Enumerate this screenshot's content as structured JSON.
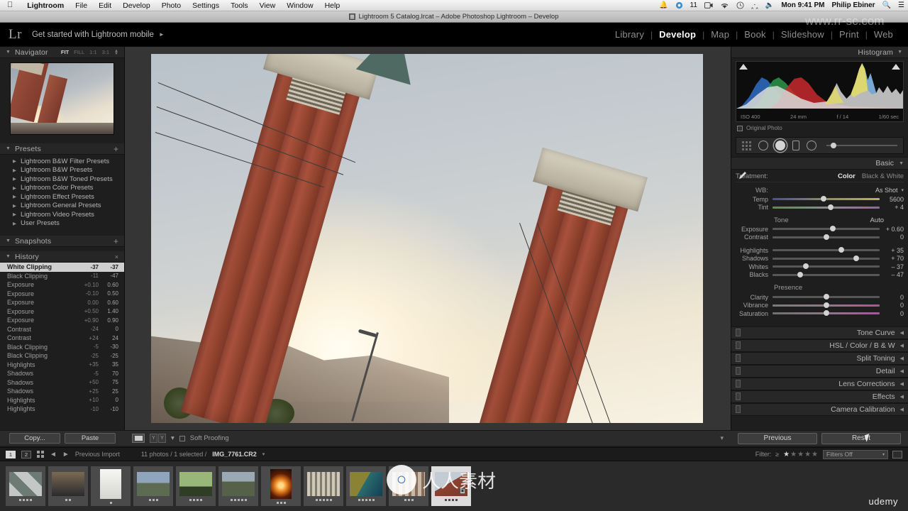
{
  "menubar": {
    "apple_icon": "apple-icon",
    "items": [
      "Lightroom",
      "File",
      "Edit",
      "Develop",
      "Photo",
      "Settings",
      "Tools",
      "View",
      "Window",
      "Help"
    ],
    "status": {
      "bell_icon": "bell-icon",
      "dropbox_icon": "dropbox-icon",
      "dropbox_count": "11",
      "screen_icon": "screen-record-icon",
      "wifi_icon": "wifi-icon",
      "clock_icon": "clock-icon",
      "bluetooth_icon": "bluetooth-icon",
      "volume_icon": "volume-icon",
      "time": "Mon 9:41 PM",
      "user": "Philip Ebiner",
      "search_icon": "search-icon",
      "notification_icon": "notification-center-icon"
    }
  },
  "titlebar": {
    "doc_icon": "catalog-file-icon",
    "title": "Lightroom 5 Catalog.lrcat – Adobe Photoshop Lightroom – Develop"
  },
  "identity": {
    "logo": "Lr",
    "tagline": "Get started with Lightroom mobile",
    "tagline_arrow": "►",
    "modules": [
      {
        "label": "Library",
        "active": false
      },
      {
        "label": "Develop",
        "active": true
      },
      {
        "label": "Map",
        "active": false
      },
      {
        "label": "Book",
        "active": false
      },
      {
        "label": "Slideshow",
        "active": false
      },
      {
        "label": "Print",
        "active": false
      },
      {
        "label": "Web",
        "active": false
      }
    ],
    "separator": "|"
  },
  "left_panel": {
    "navigator": {
      "title": "Navigator",
      "caret": "▼",
      "zoom_options": [
        "FIT",
        "FILL",
        "1:1",
        "3:1"
      ],
      "zoom_selected": "FIT",
      "stepper_icon": "stepper-icon"
    },
    "presets": {
      "title": "Presets",
      "caret": "▼",
      "add_icon": "+",
      "items": [
        "Lightroom B&W Filter Presets",
        "Lightroom B&W Presets",
        "Lightroom B&W Toned Presets",
        "Lightroom Color Presets",
        "Lightroom Effect Presets",
        "Lightroom General Presets",
        "Lightroom Video Presets",
        "User Presets"
      ]
    },
    "snapshots": {
      "title": "Snapshots",
      "caret": "▼",
      "add_icon": "+"
    },
    "history": {
      "title": "History",
      "caret": "▼",
      "clear_icon": "×",
      "entries": [
        {
          "name": "White Clipping",
          "delta": "-37",
          "value": "-37",
          "selected": true
        },
        {
          "name": "Black Clipping",
          "delta": "-11",
          "value": "-47",
          "selected": false
        },
        {
          "name": "Exposure",
          "delta": "+0.10",
          "value": "0.60",
          "selected": false
        },
        {
          "name": "Exposure",
          "delta": "-0.10",
          "value": "0.50",
          "selected": false
        },
        {
          "name": "Exposure",
          "delta": "0.00",
          "value": "0.60",
          "selected": false
        },
        {
          "name": "Exposure",
          "delta": "+0.50",
          "value": "1.40",
          "selected": false
        },
        {
          "name": "Exposure",
          "delta": "+0.90",
          "value": "0.90",
          "selected": false
        },
        {
          "name": "Contrast",
          "delta": "-24",
          "value": "0",
          "selected": false
        },
        {
          "name": "Contrast",
          "delta": "+24",
          "value": "24",
          "selected": false
        },
        {
          "name": "Black Clipping",
          "delta": "-5",
          "value": "-30",
          "selected": false
        },
        {
          "name": "Black Clipping",
          "delta": "-25",
          "value": "-25",
          "selected": false
        },
        {
          "name": "Highlights",
          "delta": "+35",
          "value": "35",
          "selected": false
        },
        {
          "name": "Shadows",
          "delta": "-5",
          "value": "70",
          "selected": false
        },
        {
          "name": "Shadows",
          "delta": "+50",
          "value": "75",
          "selected": false
        },
        {
          "name": "Shadows",
          "delta": "+25",
          "value": "25",
          "selected": false
        },
        {
          "name": "Highlights",
          "delta": "+10",
          "value": "0",
          "selected": false
        },
        {
          "name": "Highlights",
          "delta": "-10",
          "value": "-10",
          "selected": false
        }
      ]
    },
    "bottom": {
      "copy_label": "Copy...",
      "paste_label": "Paste"
    }
  },
  "center": {
    "toolbar": {
      "loupe_icon": "loupe-view-icon",
      "compare_icon": "before-after-icon",
      "compare_label": "Y|Y",
      "compare_caret": "▾",
      "soft_proofing_label": "Soft Proofing",
      "soft_proofing_checked": false,
      "right_caret": "▾"
    }
  },
  "right_panel": {
    "histogram": {
      "title": "Histogram",
      "caret": "▼",
      "shadow_clip_icon": "shadow-clipping-icon",
      "highlight_clip_icon": "highlight-clipping-icon",
      "exif": [
        "ISO 400",
        "24 mm",
        "f / 14",
        "1/60 sec"
      ],
      "original_photo_label": "Original Photo",
      "original_photo_checked": false
    },
    "tools": {
      "crop_icon": "crop-overlay-icon",
      "spot_removal_icon": "spot-removal-icon",
      "redeye_icon": "red-eye-icon",
      "graduated_filter_icon": "graduated-filter-icon",
      "radial_filter_icon": "radial-filter-icon",
      "adjustment_brush_icon": "adjustment-brush-icon"
    },
    "basic": {
      "title": "Basic",
      "caret": "▼",
      "treatment_label": "Treatment:",
      "treatment_options": [
        "Color",
        "Black & White"
      ],
      "treatment_selected": "Color",
      "eyedropper_icon": "white-balance-eyedropper-icon",
      "wb_label": "WB:",
      "wb_value": "As Shot",
      "wb_caret": "▾",
      "wb_sliders": [
        {
          "label": "Temp",
          "value": "5600",
          "pos": 48
        },
        {
          "label": "Tint",
          "value": "+ 4",
          "pos": 54
        }
      ],
      "tone_label": "Tone",
      "auto_label": "Auto",
      "tone_sliders": [
        {
          "label": "Exposure",
          "value": "+ 0.60",
          "pos": 56
        },
        {
          "label": "Contrast",
          "value": "0",
          "pos": 50
        },
        {
          "label": "Highlights",
          "value": "+ 35",
          "pos": 64
        },
        {
          "label": "Shadows",
          "value": "+ 70",
          "pos": 78
        },
        {
          "label": "Whites",
          "value": "– 37",
          "pos": 31
        },
        {
          "label": "Blacks",
          "value": "– 47",
          "pos": 26
        }
      ],
      "presence_label": "Presence",
      "presence_sliders": [
        {
          "label": "Clarity",
          "value": "0",
          "pos": 50
        },
        {
          "label": "Vibrance",
          "value": "0",
          "pos": 50
        },
        {
          "label": "Saturation",
          "value": "0",
          "pos": 50
        }
      ]
    },
    "sections": [
      "Tone Curve",
      "HSL / Color / B & W",
      "Split Toning",
      "Detail",
      "Lens Corrections",
      "Effects",
      "Camera Calibration"
    ],
    "bottom": {
      "previous_label": "Previous",
      "reset_label": "Reset"
    }
  },
  "filmstrip_bar": {
    "source_badge_1": "1",
    "source_badge_2": "2",
    "grid_icon": "grid-view-icon",
    "back_icon": "◄",
    "forward_icon": "►",
    "source_label": "Previous Import",
    "count_label": "11 photos / 1 selected /",
    "filename": "IMG_7761.CR2",
    "filename_caret": "▾",
    "filter_label": "Filter:",
    "filter_operator": "≥",
    "stars_total": 5,
    "stars_lit": 1,
    "filters_select_value": "Filters Off",
    "filters_select_caret": "▾",
    "lock_icon": "filter-lock-icon"
  },
  "filmstrip": {
    "thumbs": [
      {
        "name": "thumb-stripes",
        "rating": 4,
        "orient": "land",
        "selected": false,
        "c1": "#c3c8c6",
        "c2": "#6e7a74"
      },
      {
        "name": "thumb-bench",
        "rating": 2,
        "orient": "land",
        "selected": false,
        "c1": "#2a2a2e",
        "c2": "#7a6a52"
      },
      {
        "name": "thumb-white",
        "rating": 1,
        "orient": "port",
        "selected": false,
        "c1": "#f2f2f0",
        "c2": "#cfcfc9"
      },
      {
        "name": "thumb-valley",
        "rating": 3,
        "orient": "land",
        "selected": false,
        "c1": "#8fa4bd",
        "c2": "#5c6b52"
      },
      {
        "name": "thumb-swing",
        "rating": 4,
        "orient": "land",
        "selected": false,
        "c1": "#7f9a64",
        "c2": "#2f3d24"
      },
      {
        "name": "thumb-mountain",
        "rating": 5,
        "orient": "land",
        "selected": false,
        "c1": "#9aa9b3",
        "c2": "#3e4a33"
      },
      {
        "name": "thumb-flame",
        "rating": 3,
        "orient": "port",
        "selected": false,
        "c1": "#1b1713",
        "c2": "#e8a13c"
      },
      {
        "name": "thumb-columns",
        "rating": 5,
        "orient": "land",
        "selected": false,
        "c1": "#bdb8ab",
        "c2": "#6d6659"
      },
      {
        "name": "thumb-peacock",
        "rating": 5,
        "orient": "land",
        "selected": false,
        "c1": "#7e7a2c",
        "c2": "#2a6d6e"
      },
      {
        "name": "thumb-crowd",
        "rating": 3,
        "orient": "land",
        "selected": false,
        "c1": "#c7b9a8",
        "c2": "#8a6a58"
      },
      {
        "name": "thumb-tower",
        "rating": 4,
        "orient": "land",
        "selected": true,
        "c1": "#b9c2ca",
        "c2": "#8c4232"
      }
    ]
  },
  "watermarks": {
    "site": "www.rr-sc.com",
    "brand": "人人素材",
    "brand_icon": "brand-circle-icon",
    "udemy": "udemy"
  },
  "cursor": {
    "icon": "mouse-pointer-icon"
  }
}
